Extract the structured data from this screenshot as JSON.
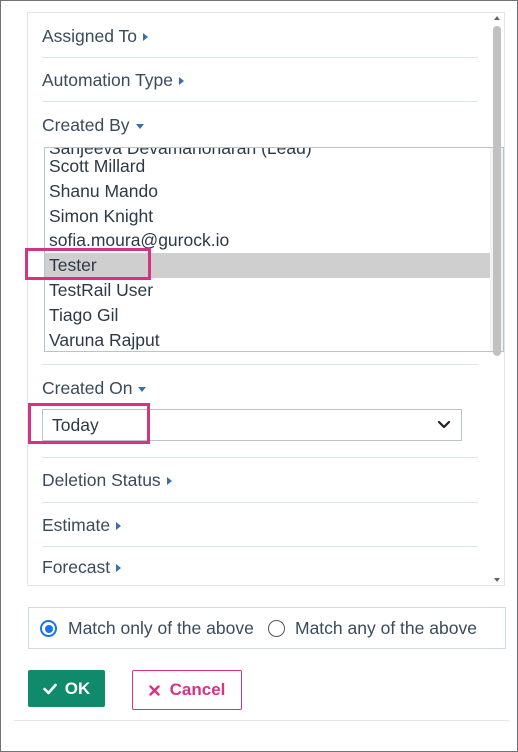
{
  "filters": {
    "assigned_to": "Assigned To",
    "automation_type": "Automation Type",
    "created_by": "Created By",
    "created_on": "Created On",
    "deletion_status": "Deletion Status",
    "estimate": "Estimate",
    "forecast": "Forecast"
  },
  "created_by_list": {
    "partial_item": "Sanjeeva Devamanoharan (Lead)",
    "items": [
      "Scott Millard",
      "Shanu Mando",
      "Simon Knight",
      "sofia.moura@gurock.io",
      "Tester",
      "TestRail User",
      "Tiago Gil",
      "Varuna Rajput"
    ],
    "selected": "Tester"
  },
  "created_on_select": {
    "value": "Today"
  },
  "match": {
    "only_label": "Match only of the above",
    "any_label": "Match any of the above",
    "selected": "only"
  },
  "buttons": {
    "ok_label": "OK",
    "cancel_label": "Cancel"
  },
  "colors": {
    "accent_blue": "#3a6fa8",
    "ok_green": "#0f8a6b",
    "cancel_pink": "#d63384",
    "highlight": "#d63384"
  }
}
